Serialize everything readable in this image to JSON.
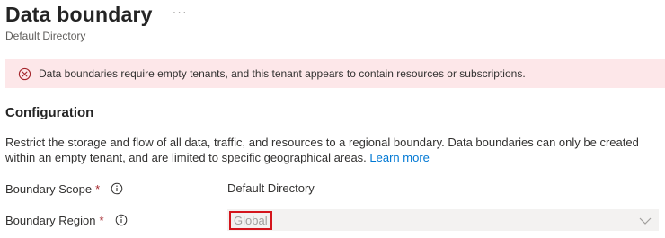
{
  "header": {
    "title": "Data boundary",
    "more_label": "···",
    "subtitle": "Default Directory"
  },
  "error_banner": {
    "message": "Data boundaries require empty tenants, and this tenant appears to contain resources or subscriptions.",
    "icon": "error-circle-icon"
  },
  "configuration": {
    "section_title": "Configuration",
    "description": "Restrict the storage and flow of all data, traffic, and resources to a regional boundary. Data boundaries can only be created within an empty tenant, and are limited to specific geographical areas.",
    "learn_more_label": "Learn more"
  },
  "fields": {
    "boundary_scope": {
      "label": "Boundary Scope",
      "required_mark": "*",
      "value": "Default Directory"
    },
    "boundary_region": {
      "label": "Boundary Region",
      "required_mark": "*",
      "selected_value": "Global"
    }
  },
  "colors": {
    "error_background": "#fde7e9",
    "error_icon": "#a4262c",
    "link": "#0078d4",
    "highlight_border": "#d4151c",
    "disabled_field": "#f3f2f1"
  }
}
